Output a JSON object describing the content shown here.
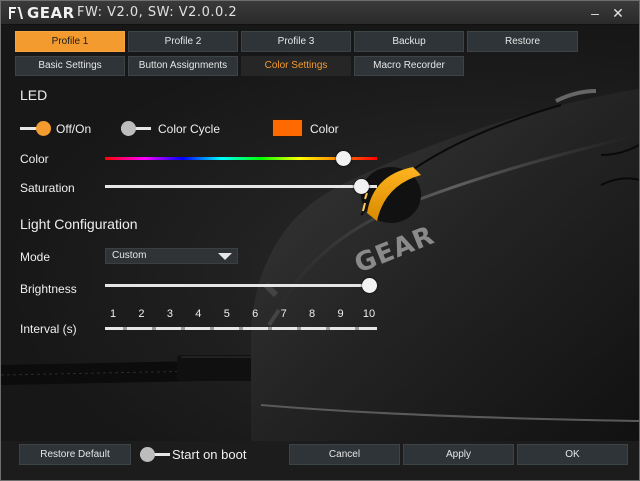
{
  "title": {
    "logo": "GEAR",
    "version": "FW: V2.0, SW: V2.0.0.2"
  },
  "window_controls": {
    "minimize": "–",
    "close": "✕"
  },
  "profiles": [
    "Profile 1",
    "Profile 2",
    "Profile 3",
    "Backup",
    "Restore"
  ],
  "active_profile": "Profile 1",
  "subtabs": [
    "Basic Settings",
    "Button Assignments",
    "Color Settings",
    "Macro Recorder"
  ],
  "active_subtab": "Color Settings",
  "led": {
    "heading": "LED",
    "off_on_label": "Off/On",
    "off_on_state": true,
    "color_cycle_label": "Color Cycle",
    "color_cycle_state": false,
    "color_label": "Color",
    "color_value": "#ff6a00",
    "color_slider_label": "Color",
    "color_slider_value": 0.9,
    "saturation_label": "Saturation",
    "saturation_value": 0.97
  },
  "light": {
    "heading": "Light Configuration",
    "mode_label": "Mode",
    "mode_value": "Custom",
    "brightness_label": "Brightness",
    "brightness_value": 1.0,
    "interval_label": "Interval (s)",
    "interval_ticks": [
      "1",
      "2",
      "3",
      "4",
      "5",
      "6",
      "7",
      "8",
      "9",
      "10"
    ],
    "interval_value": 10
  },
  "scene": {
    "mouse_brand": "GEAR"
  },
  "footer": {
    "restore_default": "Restore Default",
    "start_on_boot_label": "Start on boot",
    "start_on_boot_state": false,
    "cancel": "Cancel",
    "apply": "Apply",
    "ok": "OK"
  },
  "colors": {
    "accent": "#f39b2f",
    "button": "#2e3438",
    "background": "#1b1b1b"
  }
}
